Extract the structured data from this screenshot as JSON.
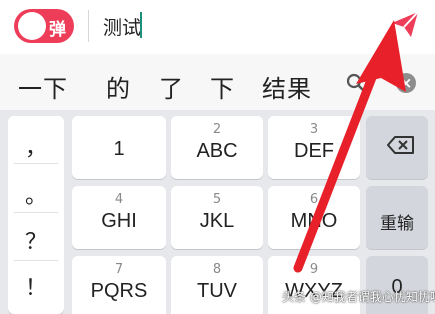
{
  "input_bar": {
    "toggle_label": "弹",
    "input_value": "测试",
    "send_icon": "send-icon",
    "accent_color": "#ee3d58"
  },
  "candidates": {
    "items": [
      "一下",
      "的",
      "了",
      "下",
      "结果"
    ],
    "search_icon": "search-icon",
    "close_icon": "close-icon",
    "close_glyph": "×"
  },
  "keyboard": {
    "punctuation": [
      "，",
      "。",
      "？",
      "！"
    ],
    "keys": [
      {
        "num": "1",
        "label": ""
      },
      {
        "num": "2",
        "label": "ABC"
      },
      {
        "num": "3",
        "label": "DEF"
      },
      {
        "num": "4",
        "label": "GHI"
      },
      {
        "num": "5",
        "label": "JKL"
      },
      {
        "num": "6",
        "label": "MNO"
      },
      {
        "num": "7",
        "label": "PQRS"
      },
      {
        "num": "8",
        "label": "TUV"
      },
      {
        "num": "9",
        "label": "WXYZ"
      }
    ],
    "backspace_icon": "backspace-icon",
    "reenter_label": "重输",
    "zero_label": "0"
  },
  "overlay": {
    "arrow_color": "#e8202a",
    "watermark": "头条 @知我者谓我心忧知忧呀"
  }
}
